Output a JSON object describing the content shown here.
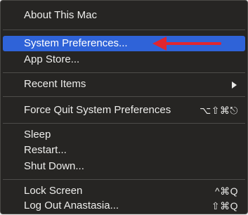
{
  "menu": {
    "items": [
      {
        "label": "About This Mac",
        "shortcut": ""
      },
      {
        "label": "System Preferences...",
        "shortcut": ""
      },
      {
        "label": "App Store...",
        "shortcut": ""
      },
      {
        "label": "Recent Items",
        "shortcut": ""
      },
      {
        "label": "Force Quit System Preferences",
        "shortcut": "⌥⇧⌘⎋"
      },
      {
        "label": "Sleep",
        "shortcut": ""
      },
      {
        "label": "Restart...",
        "shortcut": ""
      },
      {
        "label": "Shut Down...",
        "shortcut": ""
      },
      {
        "label": "Lock Screen",
        "shortcut": "^⌘Q"
      },
      {
        "label": "Log Out Anastasia...",
        "shortcut": "⇧⌘Q"
      }
    ],
    "highlighted_item": "System Preferences..."
  },
  "colors": {
    "menu_background": "#262523",
    "highlight": "#2f63d8",
    "annotation_arrow": "#e0262f"
  },
  "icons": {
    "submenu": "chevron-right-icon",
    "annotation": "red-arrow-icon"
  }
}
